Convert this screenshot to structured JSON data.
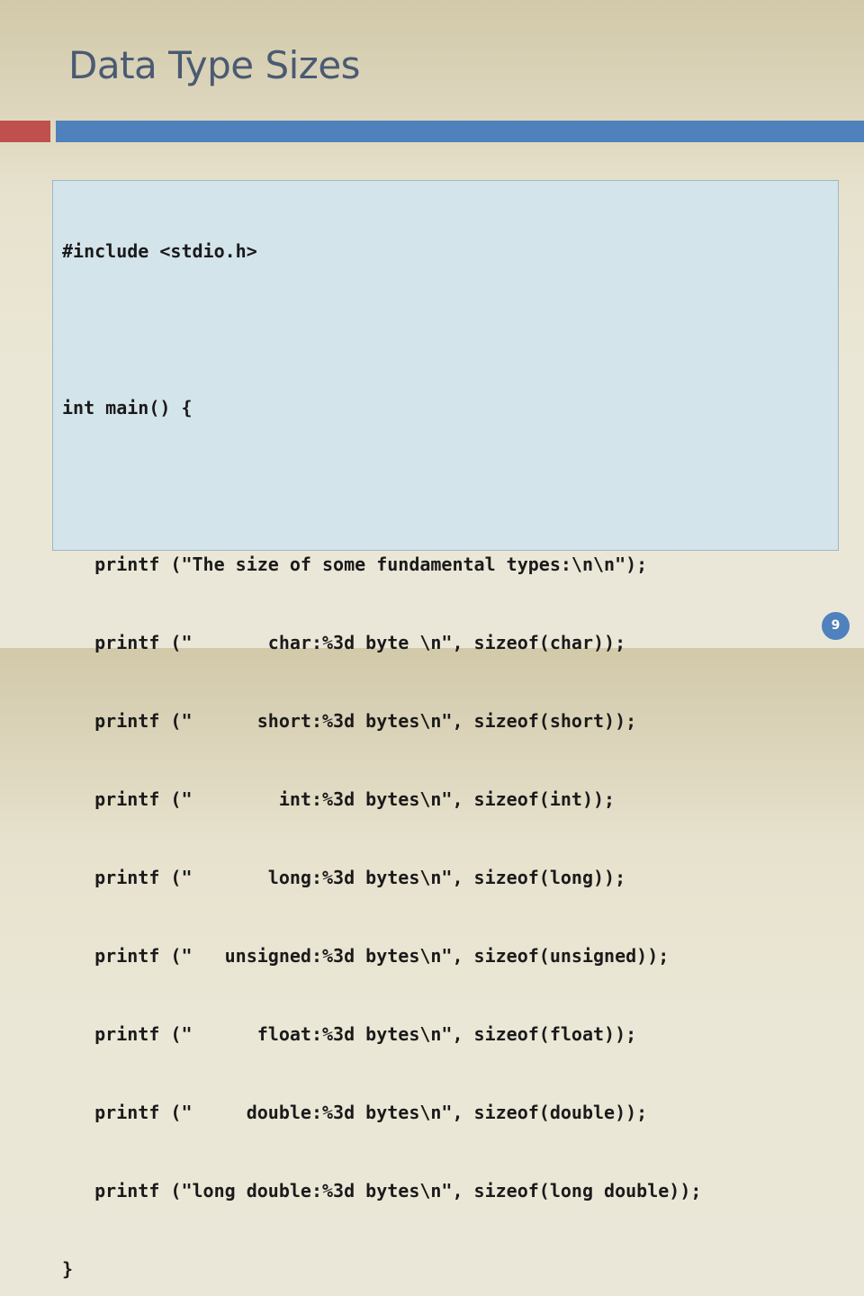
{
  "slide": {
    "title": "Data Type Sizes",
    "number": "9"
  },
  "code": {
    "language": "c",
    "lines": [
      "#include <stdio.h>",
      "",
      "int main() {",
      "",
      "   printf (\"The size of some fundamental types:\\n\\n\");",
      "   printf (\"       char:%3d byte \\n\", sizeof(char));",
      "   printf (\"      short:%3d bytes\\n\", sizeof(short));",
      "   printf (\"        int:%3d bytes\\n\", sizeof(int));",
      "   printf (\"       long:%3d bytes\\n\", sizeof(long));",
      "   printf (\"   unsigned:%3d bytes\\n\", sizeof(unsigned));",
      "   printf (\"      float:%3d bytes\\n\", sizeof(float));",
      "   printf (\"     double:%3d bytes\\n\", sizeof(double));",
      "   printf (\"long double:%3d bytes\\n\", sizeof(long double));",
      "}"
    ]
  },
  "colors": {
    "title_text": "#4a5a72",
    "accent_red": "#c0504d",
    "accent_blue": "#4f81bd",
    "code_background": "#d3e4ea",
    "slide_number_badge": "#4f81bd"
  }
}
